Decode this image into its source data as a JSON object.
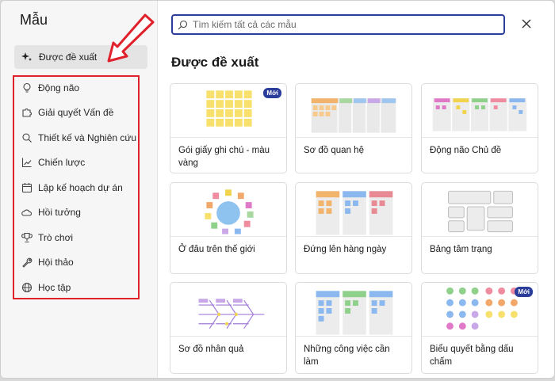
{
  "sidebar": {
    "title": "Mẫu",
    "selected": {
      "label": "Được đề xuất",
      "icon": "sparkle-icon"
    },
    "categories": [
      {
        "label": "Động não",
        "icon": "lightbulb-icon"
      },
      {
        "label": "Giải quyết Vấn đề",
        "icon": "puzzle-icon"
      },
      {
        "label": "Thiết kế và Nghiên cứu",
        "icon": "search-icon"
      },
      {
        "label": "Chiến lược",
        "icon": "trend-icon"
      },
      {
        "label": "Lập kế hoạch dự án",
        "icon": "calendar-icon"
      },
      {
        "label": "Hồi tưởng",
        "icon": "cloud-sun-icon"
      },
      {
        "label": "Trò chơi",
        "icon": "trophy-icon"
      },
      {
        "label": "Hội thảo",
        "icon": "wrench-icon"
      },
      {
        "label": "Học tập",
        "icon": "globe-icon"
      }
    ]
  },
  "search": {
    "placeholder": "Tìm kiếm tất cả các mẫu"
  },
  "main": {
    "section_title": "Được đề xuất",
    "templates": [
      {
        "label": "Gói giấy ghi chú - màu vàng",
        "badge": "Mới"
      },
      {
        "label": "Sơ đồ quan hệ",
        "badge": ""
      },
      {
        "label": "Động não Chủ đề",
        "badge": ""
      },
      {
        "label": "Ở đâu trên thế giới",
        "badge": ""
      },
      {
        "label": "Đứng lên hàng ngày",
        "badge": ""
      },
      {
        "label": "Bảng tâm trạng",
        "badge": ""
      },
      {
        "label": "Sơ đồ nhân quả",
        "badge": ""
      },
      {
        "label": "Những công việc cần làm",
        "badge": ""
      },
      {
        "label": "Biểu quyết bằng dấu chấm",
        "badge": "Mới"
      }
    ]
  },
  "colors": {
    "accent": "#2b3d9a",
    "annotation": "#e0202a",
    "sticky_yellow": "#f7e06b"
  }
}
